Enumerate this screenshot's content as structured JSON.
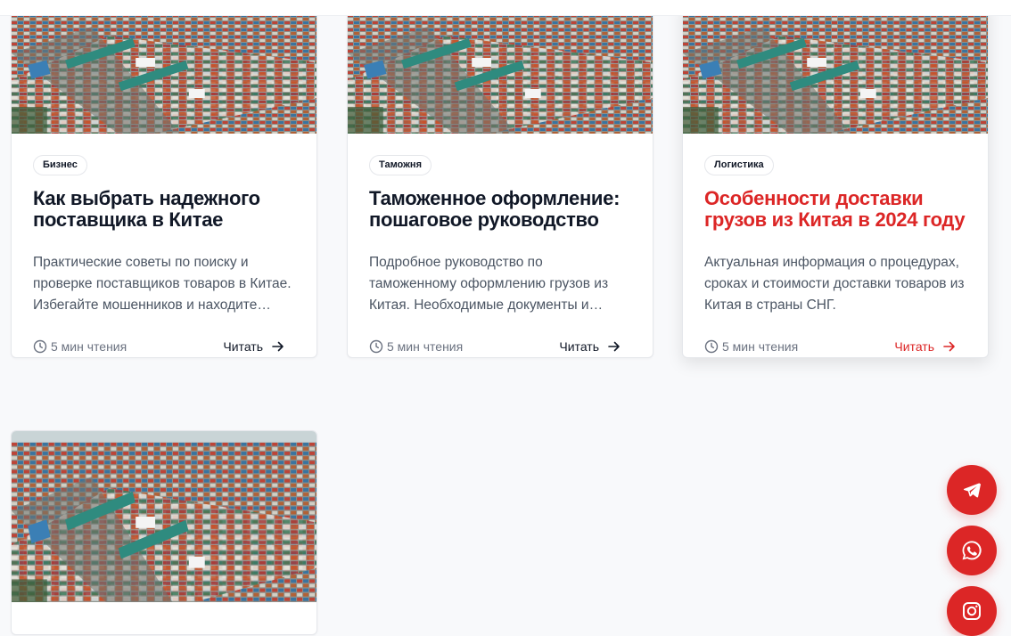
{
  "cards": [
    {
      "tag": "Бизнес",
      "title": "Как выбрать надежного поставщика в Китае",
      "excerpt": "Практические советы по поиску и проверке поставщиков товаров в Китае. Избегайте мошенников и находите надежных партнеров.",
      "read_time": "5 мин чтения",
      "read_label": "Читать"
    },
    {
      "tag": "Таможня",
      "title": "Таможенное оформление: пошаговое руководство",
      "excerpt": "Подробное руководство по таможенному оформлению грузов из Китая. Необходимые документы и сроки.",
      "read_time": "5 мин чтения",
      "read_label": "Читать"
    },
    {
      "tag": "Логистика",
      "title": "Особенности доставки грузов из Китая в 2024 году",
      "excerpt": "Актуальная информация о процедурах, сроках и стоимости доставки товаров из Китая в страны СНГ.",
      "read_time": "5 мин чтения",
      "read_label": "Читать"
    }
  ],
  "colors": {
    "accent": "#dc2626",
    "text": "#111827",
    "muted": "#6b7280"
  },
  "social": {
    "telegram_icon": "telegram-icon",
    "whatsapp_icon": "whatsapp-icon",
    "instagram_icon": "instagram-icon"
  }
}
